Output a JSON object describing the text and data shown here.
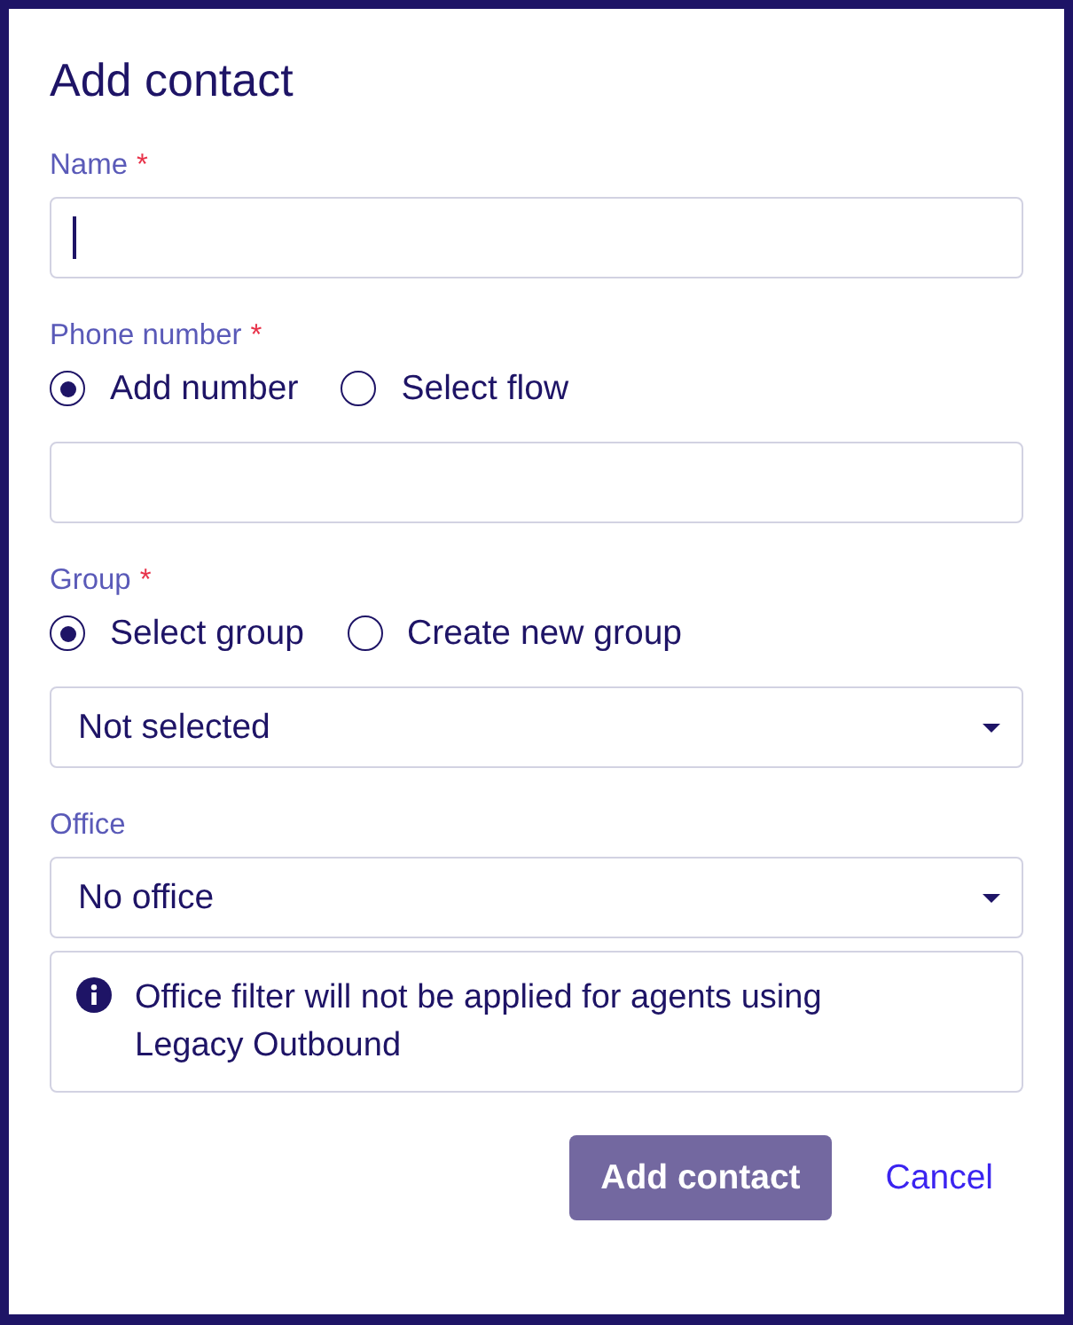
{
  "dialog": {
    "title": "Add contact"
  },
  "fields": [
    {
      "label": "Name",
      "required_mark": "*",
      "control": {
        "kind": "text",
        "focused": true
      }
    },
    {
      "label": "Phone number",
      "required_mark": "*",
      "options": [
        {
          "label": "Add number",
          "selected": true
        },
        {
          "label": "Select flow",
          "selected": false
        }
      ],
      "control": {
        "kind": "text",
        "focused": false
      }
    },
    {
      "label": "Group",
      "required_mark": "*",
      "options": [
        {
          "label": "Select group",
          "selected": true
        },
        {
          "label": "Create new group",
          "selected": false
        }
      ],
      "control": {
        "kind": "select",
        "value": "Not selected"
      }
    },
    {
      "label": "Office",
      "control": {
        "kind": "select",
        "value": "No office"
      },
      "note": "Office filter will not be applied for agents using Legacy Outbound"
    }
  ],
  "buttons": [
    {
      "label": "Add contact",
      "kind": "primary",
      "disabled": true
    },
    {
      "label": "Cancel",
      "kind": "link",
      "disabled": false
    }
  ]
}
